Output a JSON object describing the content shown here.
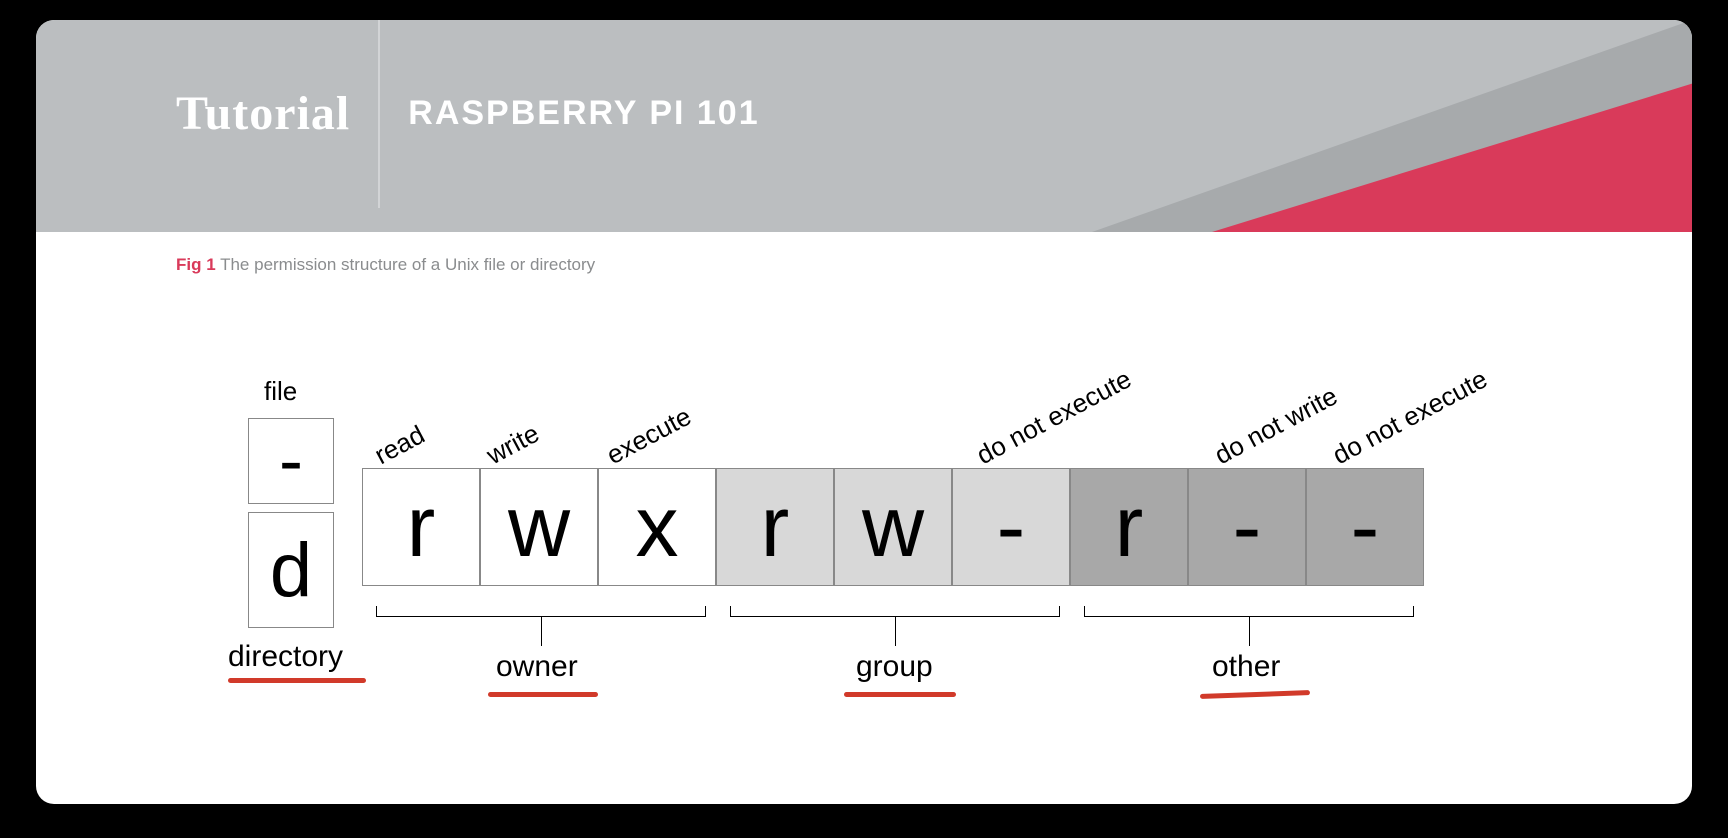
{
  "header": {
    "tag": "Tutorial",
    "title": "RASPBERRY PI 101"
  },
  "caption": {
    "fig": "Fig 1",
    "text": "The permission structure of a Unix file or directory"
  },
  "file_label": "file",
  "file_char": "-",
  "dir_char": "d",
  "dir_label": "directory",
  "owner_label": "owner",
  "group_label": "group",
  "other_label": "other",
  "perm": {
    "owner": {
      "r": "r",
      "w": "w",
      "x": "x"
    },
    "group": {
      "r": "r",
      "w": "w",
      "x": "-"
    },
    "other": {
      "r": "r",
      "w": "-",
      "x": "-"
    }
  },
  "top": {
    "read": "read",
    "write": "write",
    "execute": "execute",
    "dne1": "do not execute",
    "dnw": "do not write",
    "dne2": "do not execute"
  }
}
